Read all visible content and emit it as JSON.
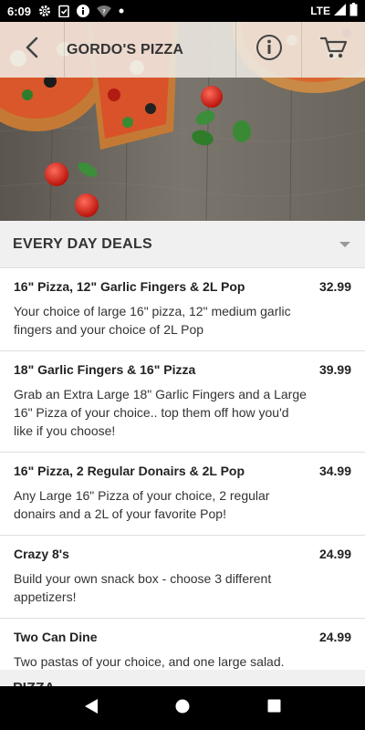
{
  "status_bar": {
    "time": "6:09",
    "network": "LTE",
    "icons": [
      "gear-icon",
      "clipboard-check-icon",
      "info-icon",
      "wifi-icon",
      "dot-icon"
    ]
  },
  "header": {
    "title": "GORDO'S PIZZA",
    "back_icon": "chevron-left-icon",
    "info_icon": "info-circle-icon",
    "cart_icon": "cart-icon"
  },
  "section": {
    "title": "EVERY DAY DEALS",
    "icon": "caret-down-icon"
  },
  "deals": [
    {
      "name": "16\" Pizza, 12\" Garlic Fingers & 2L Pop",
      "price": "32.99",
      "description": "Your choice of large 16\" pizza, 12\" medium garlic fingers and your choice of 2L Pop"
    },
    {
      "name": "18\" Garlic Fingers & 16\" Pizza",
      "price": "39.99",
      "description": "Grab an Extra Large 18\" Garlic Fingers and a Large 16\" Pizza of your choice.. top them off how you'd like if you choose!"
    },
    {
      "name": "16\" Pizza, 2 Regular Donairs & 2L Pop",
      "price": "34.99",
      "description": "Any Large 16\" Pizza of your choice, 2 regular donairs and a 2L of your favorite Pop!"
    },
    {
      "name": "Crazy 8's",
      "price": "24.99",
      "description": "Build your own snack box - choose 3 different appetizers!"
    },
    {
      "name": "Two Can Dine",
      "price": "24.99",
      "description": "Two pastas of your choice, and one large salad."
    }
  ],
  "next_section": {
    "title": "PIZZA"
  },
  "nav_bar": {
    "back_icon": "triangle-back-icon",
    "home_icon": "circle-home-icon",
    "recents_icon": "square-recents-icon"
  }
}
